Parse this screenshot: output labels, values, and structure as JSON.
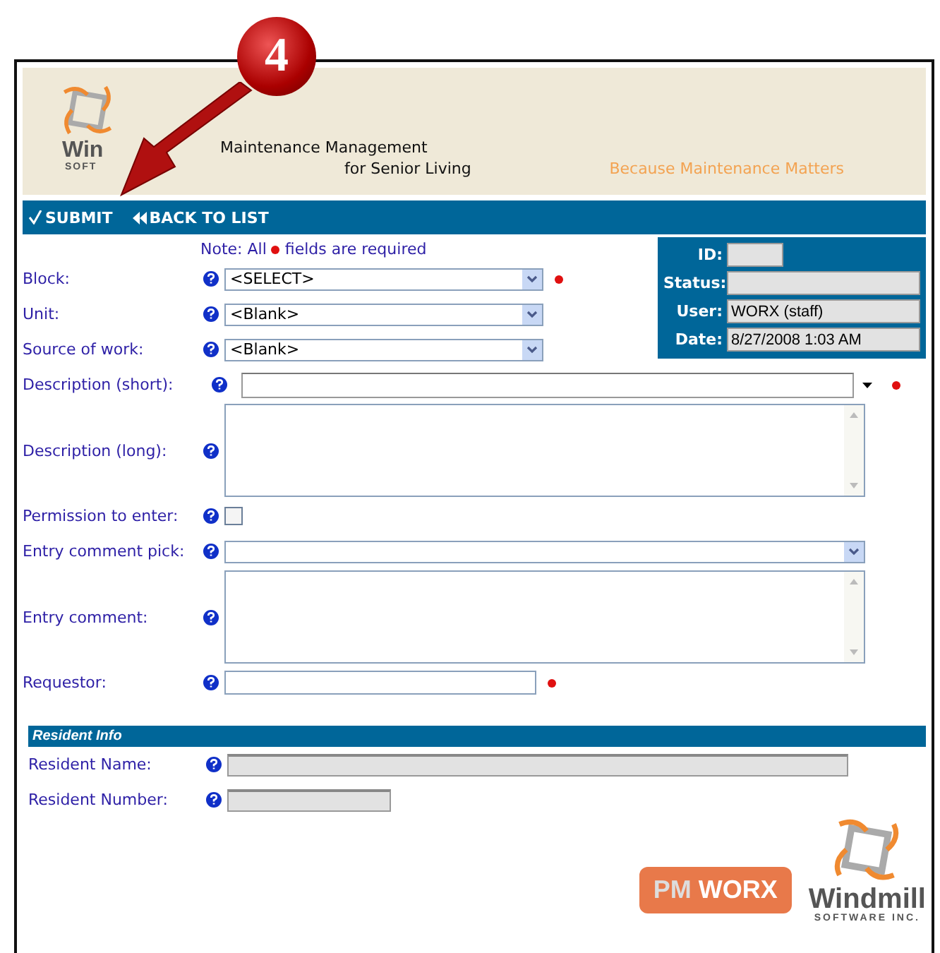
{
  "callout": {
    "number": "4"
  },
  "header": {
    "logo_text": "Win",
    "logo_subtext": "SOFT",
    "title_line1": "Maintenance Management",
    "title_line2": "for Senior Living",
    "slogan": "Because Maintenance Matters"
  },
  "toolbar": {
    "buttons": [
      {
        "label": "SUBMIT",
        "kind": "check"
      },
      {
        "label": "BACK TO LIST",
        "kind": "back"
      }
    ]
  },
  "note": {
    "before": "Note: All",
    "after": "fields are required"
  },
  "info_panel": [
    {
      "label": "ID:",
      "kind": "short"
    },
    {
      "label": "Status:",
      "kind": "long"
    },
    {
      "label": "User:",
      "value": "WORX (staff)",
      "kind": "long"
    },
    {
      "label": "Date:",
      "value": "8/27/2008 1:03 AM",
      "kind": "long"
    }
  ],
  "fields": [
    {
      "label": "Block:",
      "kind": "select",
      "value": "<SELECT>",
      "required": true
    },
    {
      "label": "Unit:",
      "kind": "select",
      "value": "<Blank>",
      "required": false
    },
    {
      "label": "Source of work:",
      "kind": "select",
      "value": "<Blank>",
      "required": false
    },
    {
      "label": "Description (short):",
      "kind": "combo",
      "required": true
    },
    {
      "label": "Description (long):",
      "kind": "textarea",
      "required": false
    },
    {
      "label": "Permission to enter:",
      "kind": "checkbox",
      "checked": false,
      "required": false
    },
    {
      "label": "Entry comment pick:",
      "kind": "wideselect",
      "required": false
    },
    {
      "label": "Entry comment:",
      "kind": "textarea",
      "required": false
    },
    {
      "label": "Requestor:",
      "kind": "text",
      "required": true
    }
  ],
  "resident_info": {
    "title": "Resident Info",
    "fields": [
      {
        "label": "Resident Name:",
        "kind": "long"
      },
      {
        "label": "Resident Number:",
        "kind": "short"
      }
    ]
  },
  "footer": {
    "badge_prefix": "PM",
    "badge_suffix": "WORX",
    "brand": "Windmill",
    "brand_sub": "SOFTWARE INC."
  }
}
